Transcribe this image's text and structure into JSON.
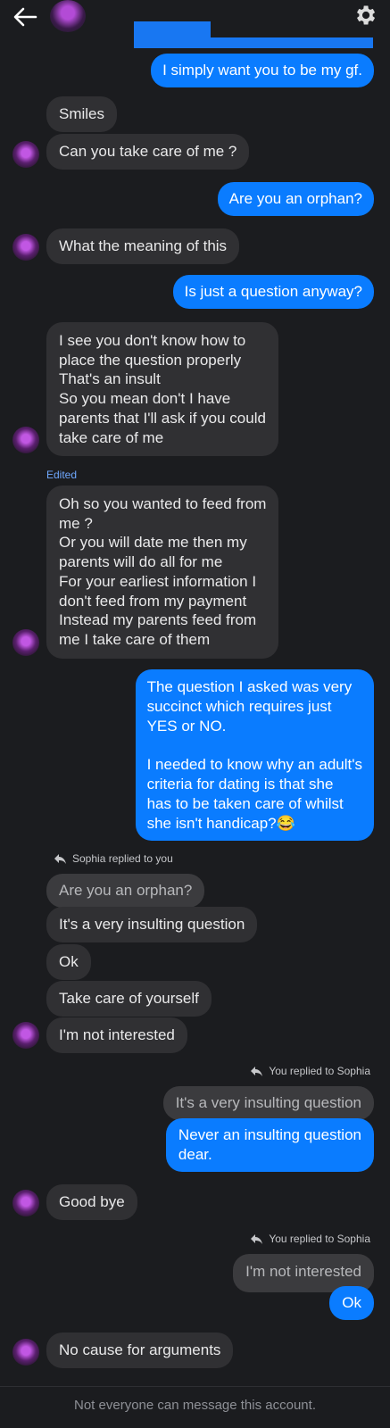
{
  "header": {
    "back": "back-arrow-icon",
    "settings": "gear-icon"
  },
  "messages": [
    {
      "text": "I simply want you to be my gf."
    },
    {
      "text": "Smiles"
    },
    {
      "text": "Can you take care of me ?"
    },
    {
      "text": "Are you an orphan?"
    },
    {
      "text": "What the meaning of this"
    },
    {
      "text": "Is just a question anyway?"
    },
    {
      "text": "I see you don't know how to\nplace the question properly\nThat's an insult\nSo you mean don't I have\nparents that I'll ask if you could\ntake care of me"
    },
    {
      "text": "Oh so you wanted to feed from\nme ?\nOr you will date me then my\nparents will do all for me\nFor your earliest information I\ndon't feed from my payment\nInstead my parents feed from\nme I take care of them"
    },
    {
      "text": "The question I asked was very\nsuccinct which requires just\nYES or NO.\n\nI needed to know why an adult's\ncriteria for dating is that she\nhas to be taken care of whilst\nshe isn't handicap?😂"
    },
    {
      "text": "Are you an orphan?"
    },
    {
      "text": "It's a very insulting question"
    },
    {
      "text": "Ok"
    },
    {
      "text": "Take care of yourself"
    },
    {
      "text": "I'm not interested"
    },
    {
      "text": "It's a very insulting question"
    },
    {
      "text": "Never an insulting question\ndear."
    },
    {
      "text": "Good bye"
    },
    {
      "text": "I'm not interested"
    },
    {
      "text": "Ok"
    },
    {
      "text": "No cause for arguments"
    }
  ],
  "labels": {
    "edited": "Edited",
    "sophia_replied": "Sophia replied to you",
    "you_replied_1": "You replied to Sophia",
    "you_replied_2": "You replied to Sophia"
  },
  "footer": "Not everyone can message this account.",
  "colors": {
    "background": "#1b1c1f",
    "outgoing": "#0a7cff",
    "incoming": "#303033",
    "edited": "#6fa8ff"
  }
}
